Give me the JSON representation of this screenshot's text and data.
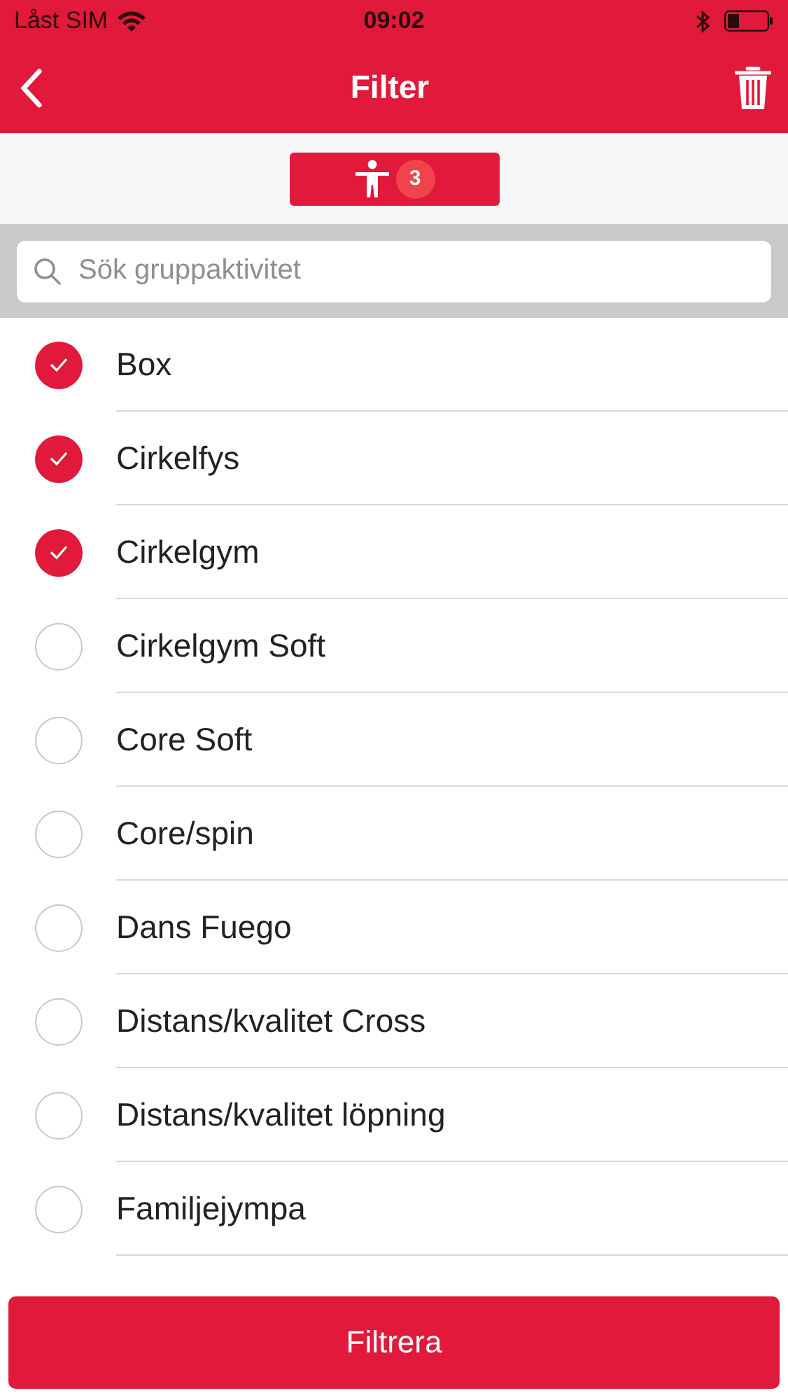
{
  "status_bar": {
    "carrier": "Låst SIM",
    "time": "09:02"
  },
  "header": {
    "title": "Filter"
  },
  "tabs": [
    {
      "badge": "3",
      "selected": true
    }
  ],
  "search": {
    "placeholder": "Sök gruppaktivitet"
  },
  "activities": [
    {
      "label": "Box",
      "checked": true
    },
    {
      "label": "Cirkelfys",
      "checked": true
    },
    {
      "label": "Cirkelgym",
      "checked": true
    },
    {
      "label": "Cirkelgym Soft",
      "checked": false
    },
    {
      "label": "Core Soft",
      "checked": false
    },
    {
      "label": "Core/spin",
      "checked": false
    },
    {
      "label": "Dans Fuego",
      "checked": false
    },
    {
      "label": "Distans/kvalitet Cross",
      "checked": false
    },
    {
      "label": "Distans/kvalitet löpning",
      "checked": false
    },
    {
      "label": "Familjejympa",
      "checked": false
    }
  ],
  "submit_button": "Filtrera"
}
